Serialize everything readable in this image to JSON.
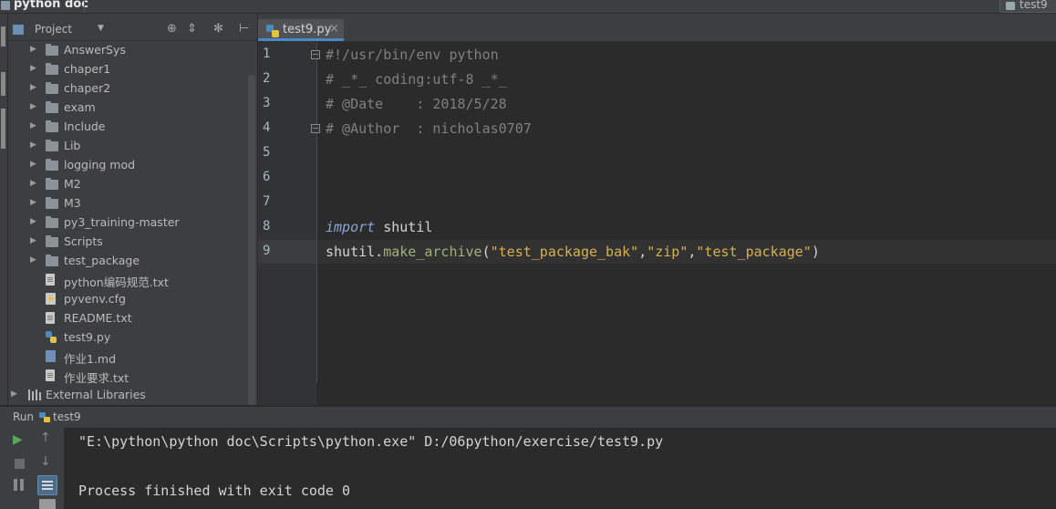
{
  "window": {
    "title": "python doc",
    "run_config": "test9"
  },
  "project_panel": {
    "title": "Project",
    "items": [
      {
        "label": "AnswerSys",
        "type": "folder"
      },
      {
        "label": "chaper1",
        "type": "folder"
      },
      {
        "label": "chaper2",
        "type": "folder"
      },
      {
        "label": "exam",
        "type": "folder"
      },
      {
        "label": "Include",
        "type": "folder"
      },
      {
        "label": "Lib",
        "type": "folder"
      },
      {
        "label": "logging mod",
        "type": "folder"
      },
      {
        "label": "M2",
        "type": "folder"
      },
      {
        "label": "M3",
        "type": "folder"
      },
      {
        "label": "py3_training-master",
        "type": "folder"
      },
      {
        "label": "Scripts",
        "type": "folder"
      },
      {
        "label": "test_package",
        "type": "folder"
      },
      {
        "label": "python编码规范.txt",
        "type": "text-file"
      },
      {
        "label": "pyvenv.cfg",
        "type": "cfg-file"
      },
      {
        "label": "README.txt",
        "type": "text-file"
      },
      {
        "label": "test9.py",
        "type": "python-file"
      },
      {
        "label": "作业1.md",
        "type": "markdown-file"
      },
      {
        "label": "作业要求.txt",
        "type": "text-file"
      },
      {
        "label": "External Libraries",
        "type": "libraries"
      }
    ]
  },
  "editor": {
    "tab": {
      "label": "test9.py",
      "close": "×"
    },
    "lines": [
      {
        "num": "1",
        "comment": "#!/usr/bin/env python"
      },
      {
        "num": "2",
        "comment": "# _*_ coding:utf-8 _*_"
      },
      {
        "num": "3",
        "comment": "# @Date    : 2018/5/28"
      },
      {
        "num": "4",
        "comment": "# @Author  : nicholas0707"
      },
      {
        "num": "5"
      },
      {
        "num": "6"
      },
      {
        "num": "7"
      },
      {
        "num": "8",
        "keyword": "import",
        "ident": " shutil"
      },
      {
        "num": "9",
        "ident": "shutil.",
        "func": "make_archive",
        "open": "(",
        "s1": "\"test_package_bak\"",
        "comma1": ",",
        "s2": "\"zip\"",
        "comma2": ",",
        "s3": "\"test_package\"",
        "close": ")"
      }
    ]
  },
  "run_panel": {
    "label": "Run",
    "tab_label": "test9",
    "output": [
      "\"E:\\python\\python doc\\Scripts\\python.exe\" D:/06python/exercise/test9.py",
      "Process finished with exit code 0"
    ]
  },
  "icons": {
    "rerun": "▶",
    "up": "↑",
    "down": "↓",
    "dropdown": "▼",
    "arrow": "▶",
    "target": "⊕",
    "collapse": "⇕",
    "gear": "✻",
    "hide": "⊢"
  },
  "colors": {
    "background": "#2b2b2b",
    "panel": "#3c3f41",
    "comment": "#808080",
    "keyword": "#8aa4d6",
    "string": "#d7b04f",
    "function": "#a0b27c",
    "tab_accent": "#4a88c7"
  }
}
